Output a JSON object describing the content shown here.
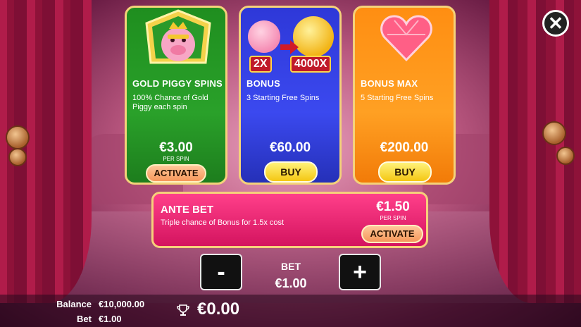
{
  "close_icon": "close-icon",
  "cards": [
    {
      "title": "GOLD PIGGY SPINS",
      "description": "100% Chance of Gold Piggy each spin",
      "price": "€3.00",
      "per_spin": "PER SPIN",
      "action": "ACTIVATE",
      "color": "#2aa12a"
    },
    {
      "title": "BONUS",
      "description": "3 Starting Free Spins",
      "price": "€60.00",
      "action": "BUY",
      "multiplier_low": "2X",
      "multiplier_high": "4000X",
      "color": "#3b49ef"
    },
    {
      "title": "BONUS MAX",
      "description": "5 Starting Free Spins",
      "price": "€200.00",
      "action": "BUY",
      "color": "#ffa023"
    }
  ],
  "ante_bet": {
    "title": "ANTE BET",
    "description": "Triple chance of Bonus for 1.5x cost",
    "price": "€1.50",
    "per_spin": "PER SPIN",
    "action": "ACTIVATE"
  },
  "bet_control": {
    "minus": "-",
    "plus": "+",
    "label": "BET",
    "value": "€1.00"
  },
  "footer": {
    "balance_label": "Balance",
    "balance_value": "€10,000.00",
    "bet_label": "Bet",
    "bet_value": "€1.00",
    "win_value": "€0.00",
    "win_icon": "trophy-icon"
  }
}
